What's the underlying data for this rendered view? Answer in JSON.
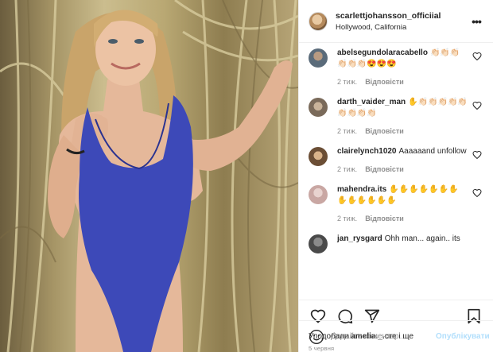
{
  "post": {
    "username": "scarlettjohansson_officiial",
    "location": "Hollywood, California",
    "more_icon": "more-horizontal-icon"
  },
  "comments": [
    {
      "user": "abelsegundolaracabello",
      "text": "👏🏻👏🏻👏🏻👏🏻👏🏻👏🏻😍😍😍",
      "time": "2 тиж.",
      "reply": "Відповісти",
      "avatar_color": "#5a6b7a"
    },
    {
      "user": "darth_vaider_man",
      "text": "✋👏🏻👏🏻👏🏻👏🏻👏🏻👏🏻👏🏻👏🏻👏🏻",
      "time": "2 тиж.",
      "reply": "Відповісти",
      "avatar_color": "#7a6a5a"
    },
    {
      "user": "clairelynch1020",
      "text": "Aaaaaand unfollow",
      "time": "2 тиж.",
      "reply": "Відповісти",
      "avatar_color": "#6b4e35"
    },
    {
      "user": "mahendra.its",
      "text": "✋✋✋✋✋✋✋✋✋✋✋✋✋",
      "time": "2 тиж.",
      "reply": "Відповісти",
      "avatar_color": "#c9a7a3"
    },
    {
      "user": "jan_rysgard",
      "text": "Ohh man... again.. its",
      "time": "",
      "reply": "",
      "avatar_color": "#4a4a4a"
    }
  ],
  "actions": {
    "like_icon": "heart-icon",
    "comment_icon": "comment-icon",
    "share_icon": "send-icon",
    "save_icon": "bookmark-icon"
  },
  "likes": {
    "prefix": "Уподобали ",
    "user": "amelia._.cre",
    "suffix": " і ще"
  },
  "date": "5 червня",
  "add_comment": {
    "placeholder": "Додайте коментар...",
    "post_label": "Опублікувати",
    "smile_icon": "smile-icon"
  }
}
